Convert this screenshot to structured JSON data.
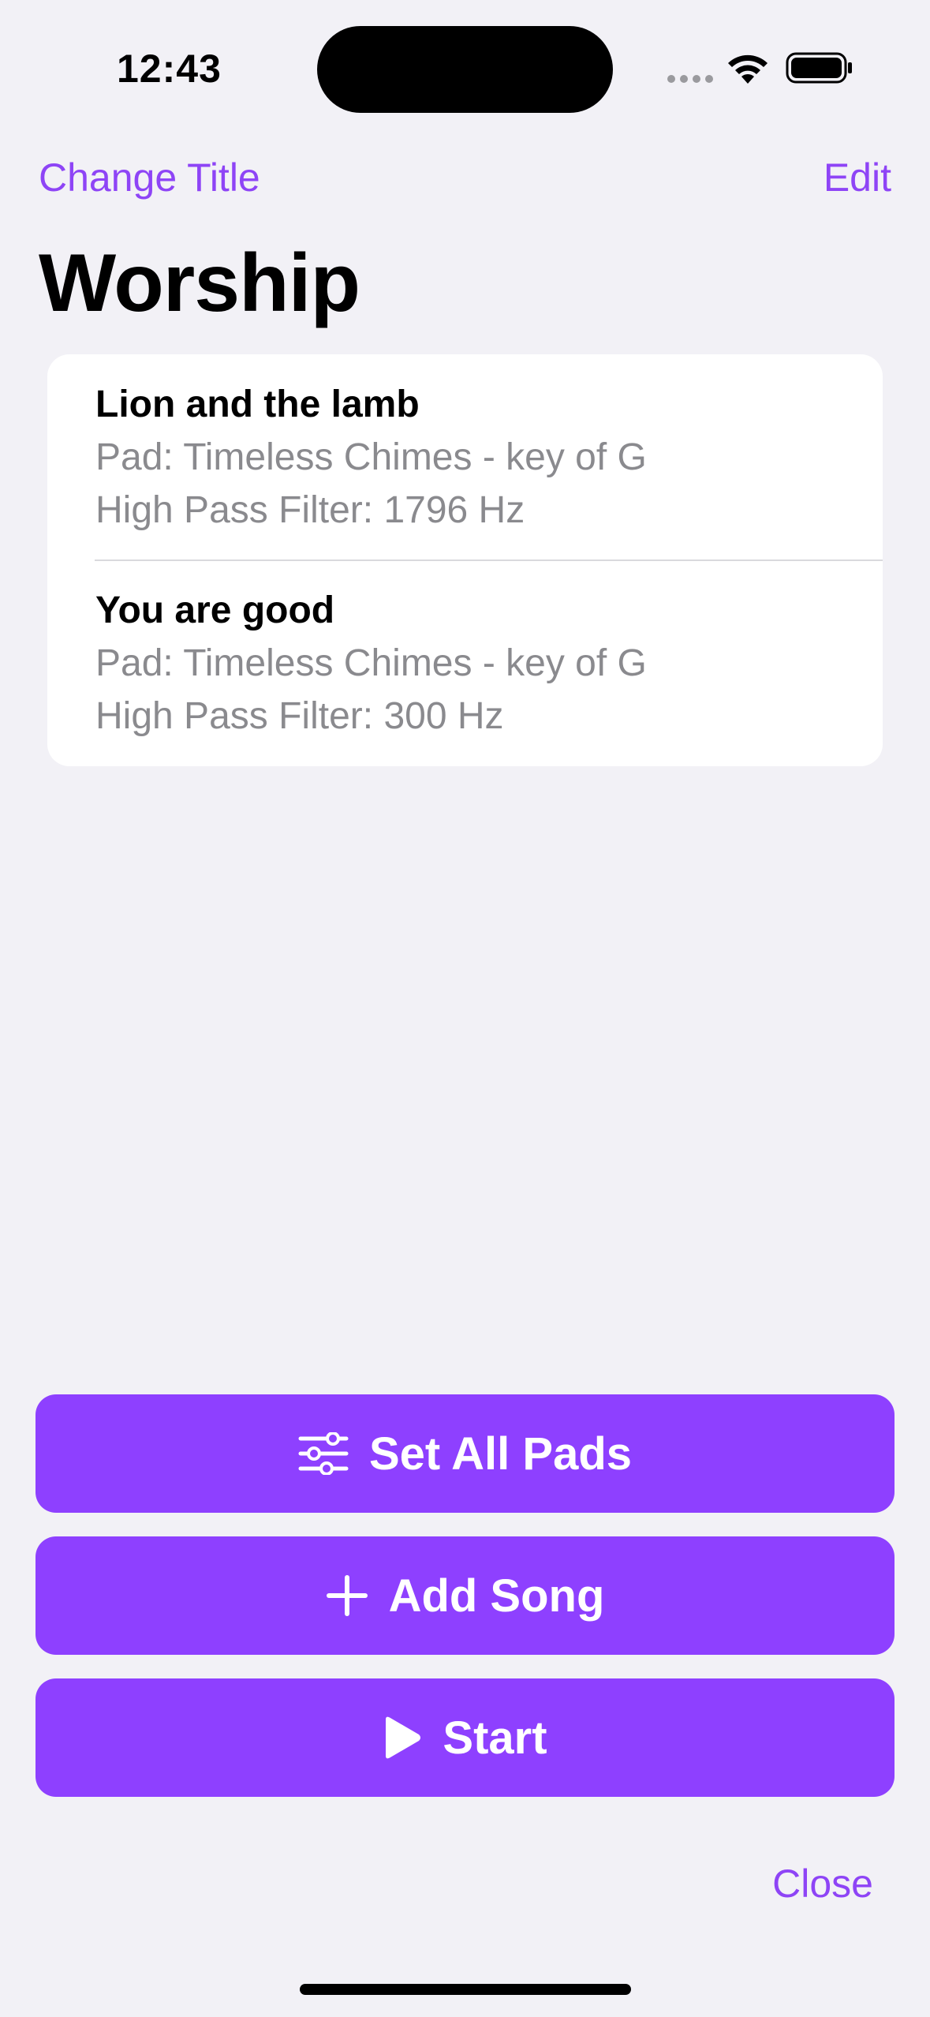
{
  "status_bar": {
    "time": "12:43"
  },
  "nav": {
    "change_title": "Change Title",
    "edit": "Edit"
  },
  "page": {
    "title": "Worship"
  },
  "songs": [
    {
      "name": "Lion and the lamb",
      "pad": "Pad: Timeless Chimes - key of G",
      "filter": "High Pass Filter: 1796 Hz"
    },
    {
      "name": "You are good",
      "pad": "Pad: Timeless Chimes - key of G",
      "filter": "High Pass Filter: 300 Hz"
    }
  ],
  "buttons": {
    "set_all_pads": {
      "label": "Set All Pads",
      "icon": "sliders-icon"
    },
    "add_song": {
      "label": "Add Song",
      "icon": "plus-icon"
    },
    "start": {
      "label": "Start",
      "icon": "play-icon"
    }
  },
  "footer": {
    "close": "Close"
  },
  "colors": {
    "accent": "#8E40FF",
    "background": "#F2F1F6",
    "secondary_text": "#8A8A8E"
  }
}
